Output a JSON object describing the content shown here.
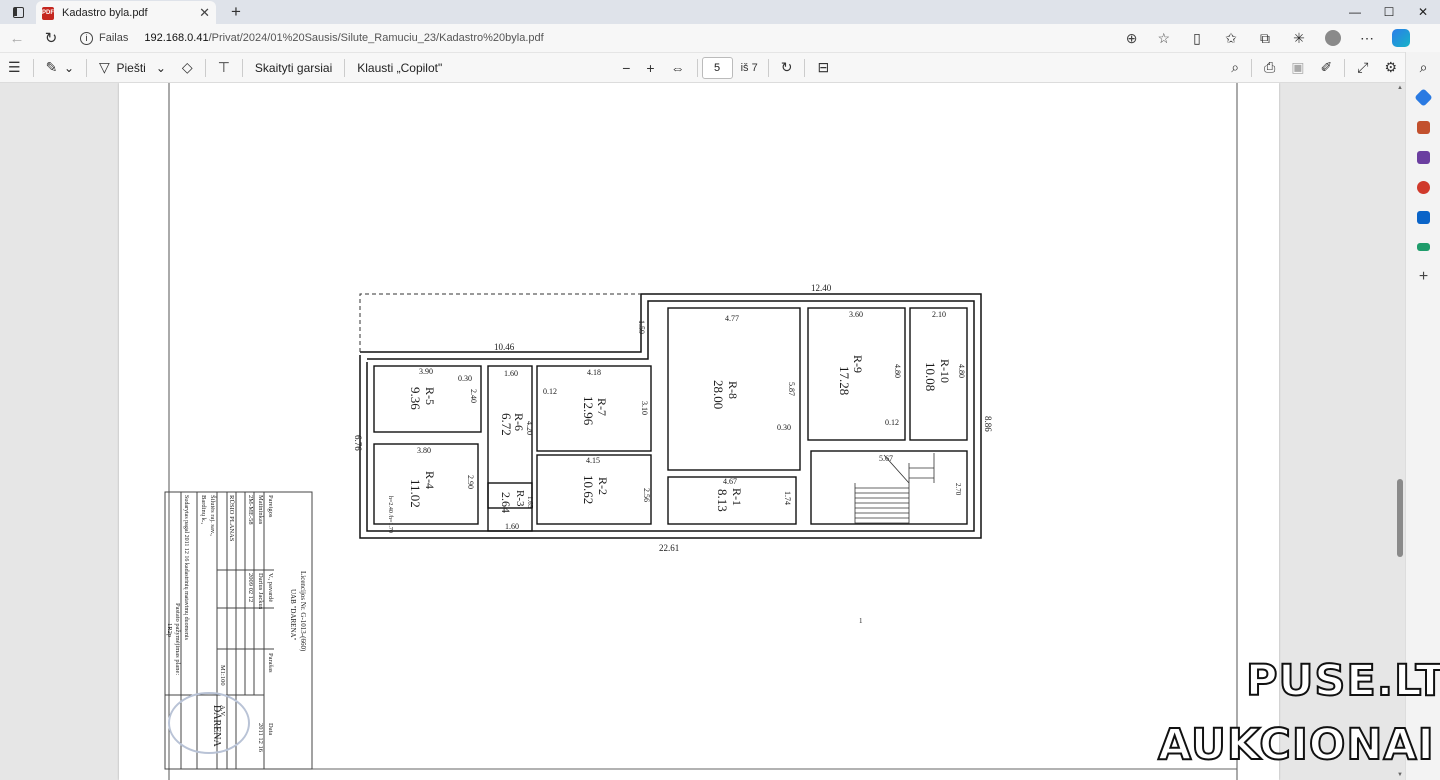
{
  "browser": {
    "tab_title": "Kadastro byla.pdf",
    "tab_close": "✕",
    "new_tab": "+",
    "scheme_label": "Failas",
    "url_host": "192.168.0.41",
    "url_path": "/Privat/2024/01%20Sausis/Silute_Ramuciu_23/Kadastro%20byla.pdf",
    "window_controls": [
      "—",
      "☐",
      "✕"
    ]
  },
  "pdf_toolbar": {
    "draw_label": "Piešti",
    "read_aloud_label": "Skaityti garsiai",
    "copilot_label": "Klausti „Copilot\"",
    "page_current": "5",
    "page_total": "iš 7"
  },
  "floor_plan": {
    "overall_width": "22.61",
    "top_width": "12.40",
    "left_top": "10.46",
    "right_height": "8.86",
    "left_height": "6.76",
    "notch": "1.59",
    "rooms": [
      {
        "id": "R-8",
        "area": "28.00",
        "dim_w": "4.77",
        "dim_h": "5.87",
        "extra": "0.30"
      },
      {
        "id": "R-9",
        "area": "17.28",
        "dim_w": "3.60",
        "dim_h": "4.80",
        "extra": "0.12"
      },
      {
        "id": "R-10",
        "area": "10.08",
        "dim_w": "2.10",
        "dim_h": "4.80"
      },
      {
        "id": "R-5",
        "area": "9.36",
        "dim_w": "3.90",
        "dim_h": "2.40",
        "extra": "0.30"
      },
      {
        "id": "R-6",
        "area": "6.72",
        "dim_w": "1.60",
        "dim_h": "4.20"
      },
      {
        "id": "R-7",
        "area": "12.96",
        "dim_w": "4.18",
        "dim_h": "3.10",
        "extra": "0.12"
      },
      {
        "id": "R-4",
        "area": "11.02",
        "dim_w": "3.80",
        "dim_h": "2.90",
        "extra": "h=2.40 /h=1.70"
      },
      {
        "id": "R-3",
        "area": "2.64",
        "dim_w": "1.60",
        "dim_h": "1.65"
      },
      {
        "id": "R-2",
        "area": "10.62",
        "dim_w": "4.15",
        "dim_h": "2.56"
      },
      {
        "id": "R-1",
        "area": "8.13",
        "dim_w": "4.67",
        "dim_h": "1.74"
      }
    ],
    "stair_dim": "5.67",
    "stair_dim2": "2.70",
    "stray_mark": "1"
  },
  "title_block": {
    "company": "UAB \"DARENA\"",
    "license": "Licencijos Nr. G-1013-(660)",
    "col_role": "Pareigos",
    "col_name": "V., pavardė",
    "col_sign": "Parašas",
    "col_date": "Data",
    "role": "Matininkas",
    "role_code": "2M-ME-58",
    "name": "Darius Jackus",
    "cert_date": "2009 02 12",
    "date": "2011 12 16",
    "plan_title": "RŪSIO PLANAS",
    "scale": "M1:100",
    "sheet": "A.V.",
    "address1": "Šilutės raj. sav.,",
    "address2": "Bardinų k.,",
    "doc_note": "Sudarytas pagal 2011 12 16 kadastrinių matavimų duomenis",
    "area_label": "Pastato pažymėjimas plane:",
    "area_code": "1R2p",
    "stamp_text": "DARENA"
  },
  "watermark": {
    "line1": "PUSE.LT",
    "line2": "AUKCIONAI"
  }
}
